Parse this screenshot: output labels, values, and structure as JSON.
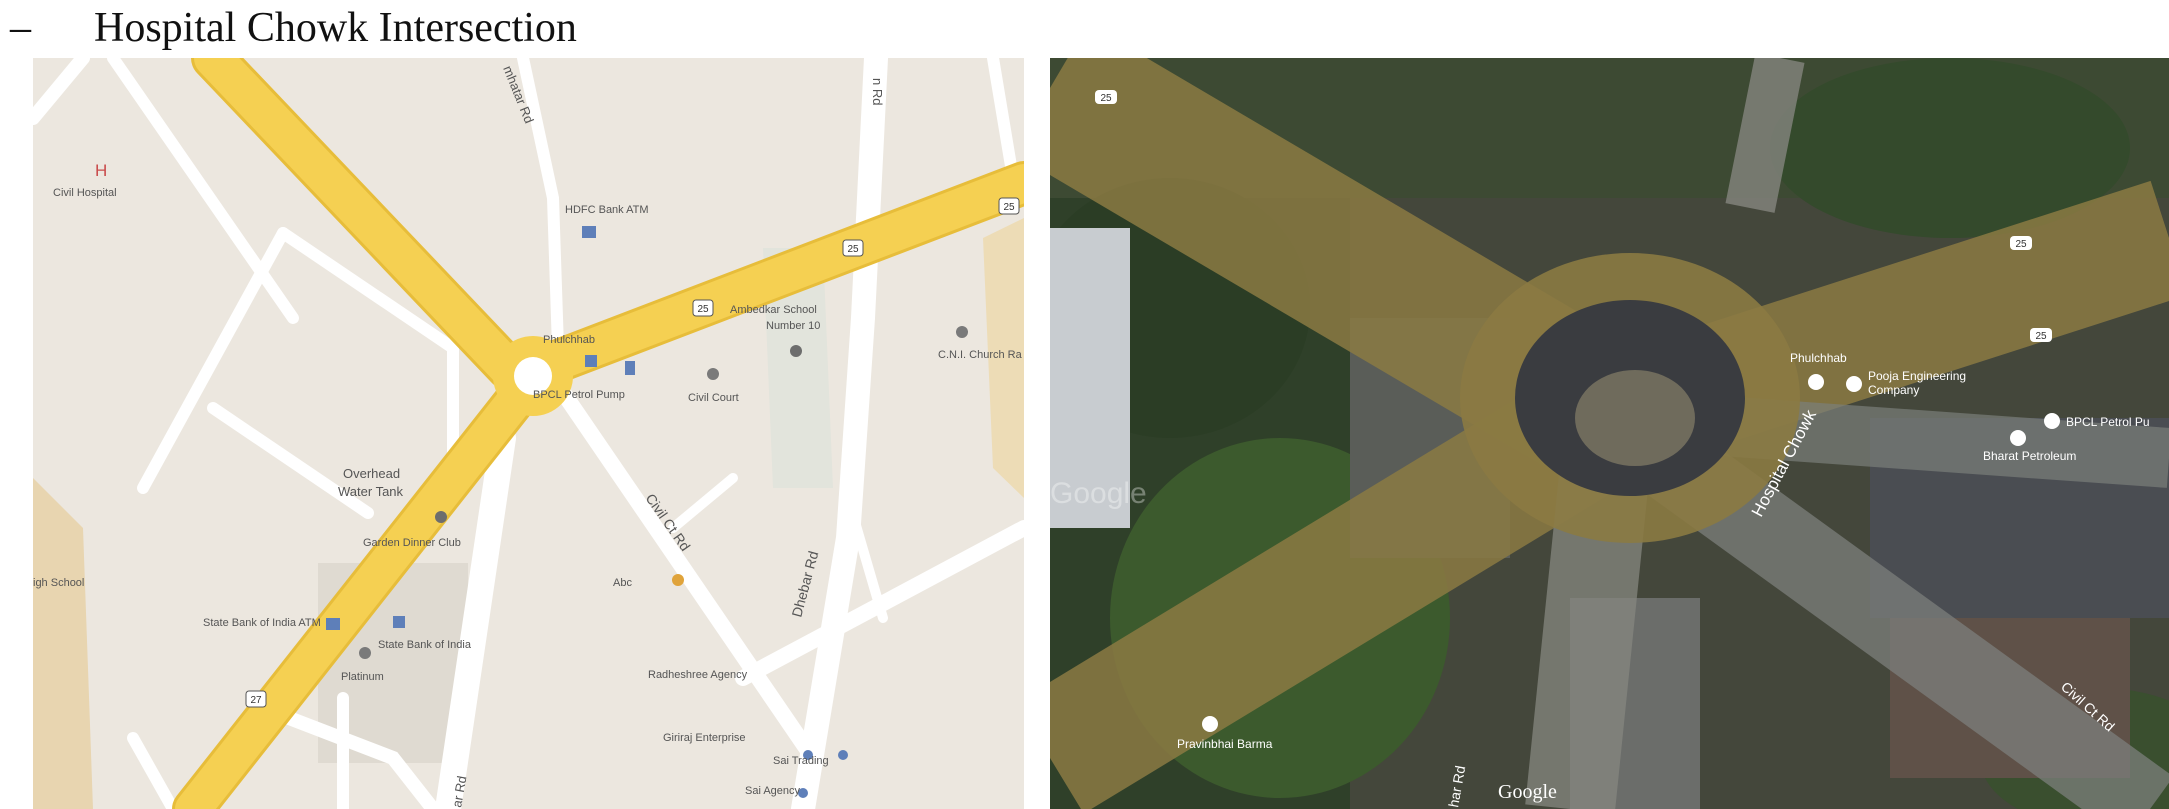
{
  "caption": {
    "dash": "–",
    "title": "Hospital Chowk Intersection"
  },
  "map": {
    "labels": {
      "hospital_symbol": "H",
      "civil_hospital": "Civil Hospital",
      "hdfc_atm": "HDFC Bank ATM",
      "phulchhab": "Phulchhab",
      "bpcl_pump": "BPCL Petrol Pump",
      "ambedkar_school_1": "Ambedkar School",
      "ambedkar_school_2": "Number 10",
      "cni_church": "C.N.I. Church Ra",
      "civil_court": "Civil Court",
      "overhead_tank_1": "Overhead",
      "overhead_tank_2": "Water Tank",
      "garden_dinner": "Garden Dinner Club",
      "high_school": "igh School",
      "sbi_atm": "State Bank of India ATM",
      "sbi": "State Bank of India",
      "platinum": "Platinum",
      "abc": "Abc",
      "civil_ct_rd": "Civil Ct Rd",
      "dhebar_rd": "Dhebar Rd",
      "road_top": "mhatar Rd",
      "road_top2": "n Rd",
      "road_bottom": "ar Rd",
      "radheshree": "Radheshree Agency",
      "giriraj": "Giriraj Enterprise",
      "sai_trading": "Sai Trading",
      "sai_agency": "Sai Agency",
      "route_27": "27",
      "route_25": "25"
    }
  },
  "satellite": {
    "labels": {
      "route_25_a": "25",
      "route_25_b": "25",
      "route_25_c": "25",
      "phulchhab": "Phulchhab",
      "pooja_1": "Pooja Engineering",
      "pooja_2": "Company",
      "bpcl": "BPCL Petrol Pu",
      "bharat": "Bharat Petroleum",
      "hospital_chowk": "Hospital Chowk",
      "civil_ct_rd": "Civil Ct Rd",
      "pravinbhai": "Pravinbhai Barma",
      "road_bottom": "har Rd",
      "google": "Google",
      "google_wm": "Google"
    }
  },
  "colors": {
    "map_land": "#ece7df",
    "map_road_major": "#f5d052",
    "map_road_minor": "#ffffff",
    "sat_overlay": "#8b7a43",
    "sat_center": "#3a3c40"
  }
}
